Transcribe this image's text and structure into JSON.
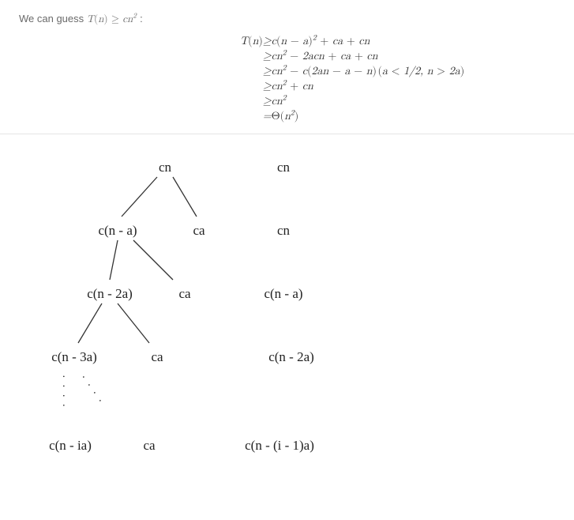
{
  "intro": {
    "prefix": "We can guess ",
    "math_expr": "T(n) ≥ cn²",
    "suffix": " :"
  },
  "equation": {
    "lines": [
      {
        "lhs": "T(n)",
        "rel": "≥",
        "rhs": "c(n − a)² + ca + cn",
        "cond": ""
      },
      {
        "lhs": "",
        "rel": "≥",
        "rhs": "cn² − 2acn + ca + cn",
        "cond": ""
      },
      {
        "lhs": "",
        "rel": "≥",
        "rhs": "cn² − c(2an − a − n)",
        "cond": "(a < 1/2, n > 2a)"
      },
      {
        "lhs": "",
        "rel": "≥",
        "rhs": "cn² + cn",
        "cond": ""
      },
      {
        "lhs": "",
        "rel": "≥",
        "rhs": "cn²",
        "cond": ""
      },
      {
        "lhs": "",
        "rel": "=",
        "rhs": "Θ(n²)",
        "cond": ""
      }
    ]
  },
  "tree": {
    "left_nodes": {
      "l0": "cn",
      "l1l": "c(n - a)",
      "l1r": "ca",
      "l2l": "c(n - 2a)",
      "l2r": "ca",
      "l3l": "c(n - 3a)",
      "l3r": "ca",
      "l4l": "c(n - ia)",
      "l4r": "ca"
    },
    "right_col": {
      "r0": "cn",
      "r1": "cn",
      "r2": "c(n - a)",
      "r3": "c(n - 2a)",
      "r4": "c(n - (i - 1)a)"
    },
    "dots": "· · · ·"
  }
}
